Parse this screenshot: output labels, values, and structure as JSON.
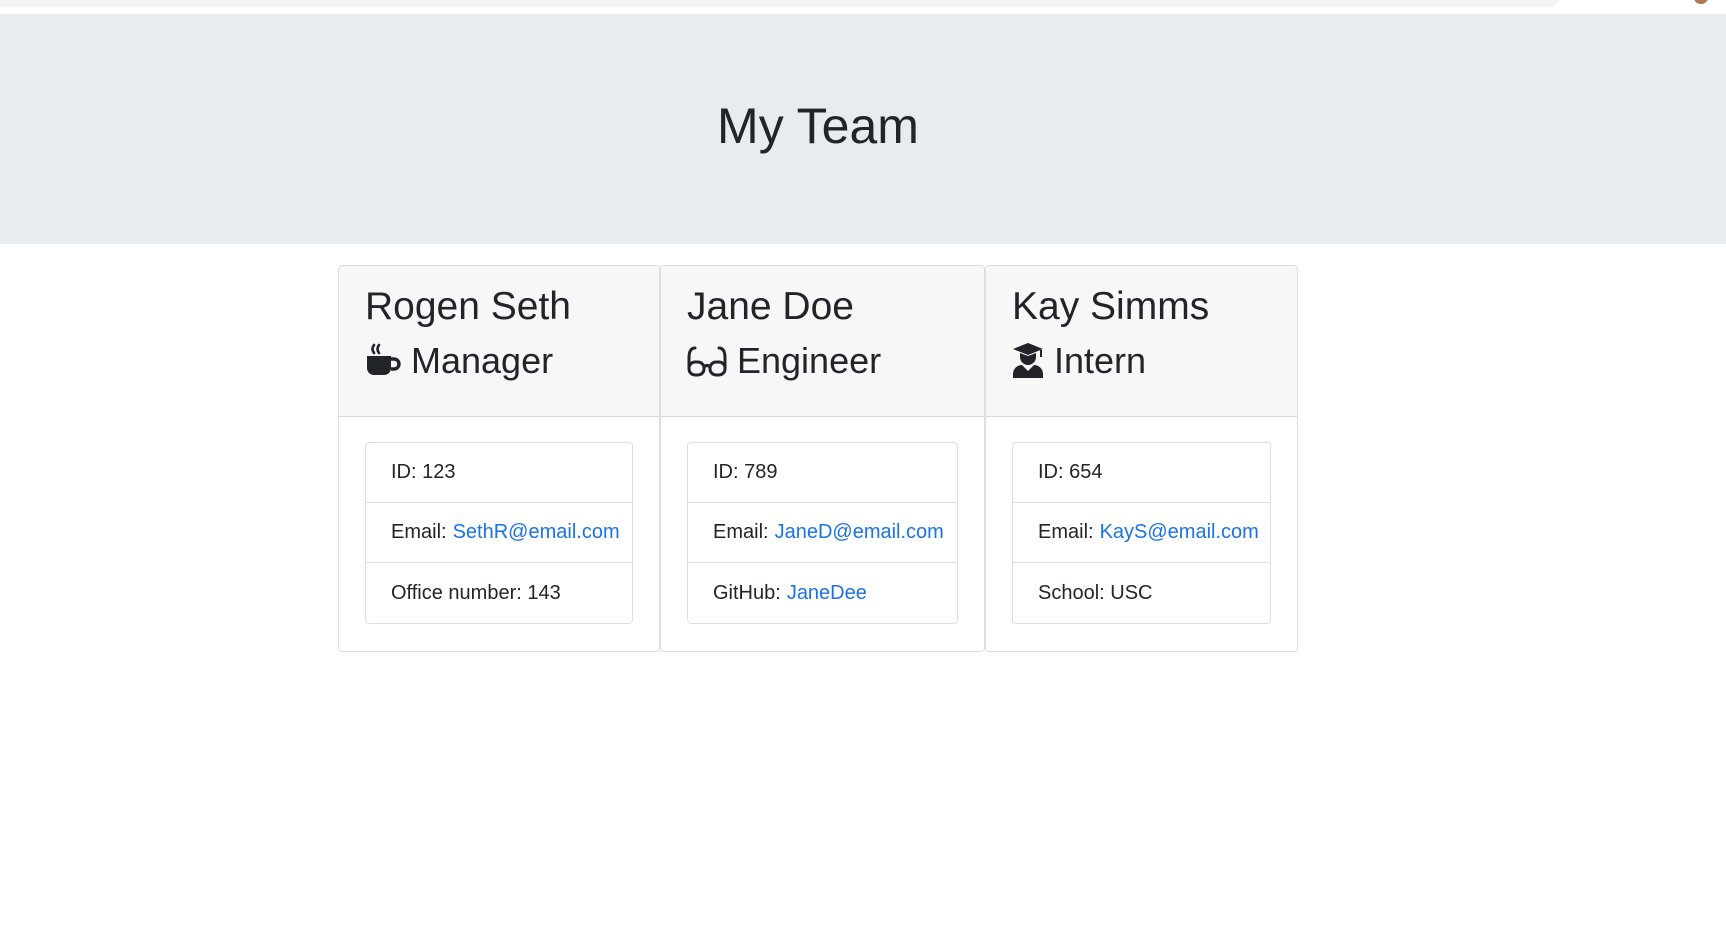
{
  "header": {
    "title": "My Team"
  },
  "employees": [
    {
      "name": "Rogen Seth",
      "role": "Manager",
      "icon": "coffee-mug-icon",
      "id_text": "ID: 123",
      "email_label": "Email:",
      "email": "SethR@email.com",
      "extra_label": "Office number: 143",
      "extra_link": ""
    },
    {
      "name": "Jane Doe",
      "role": "Engineer",
      "icon": "glasses-icon",
      "id_text": "ID: 789",
      "email_label": "Email:",
      "email": "JaneD@email.com",
      "extra_label": "GitHub:",
      "extra_link": "JaneDee"
    },
    {
      "name": "Kay Simms",
      "role": "Intern",
      "icon": "graduate-icon",
      "id_text": "ID: 654",
      "email_label": "Email:",
      "email": "KayS@email.com",
      "extra_label": "School: USC",
      "extra_link": ""
    }
  ],
  "colors": {
    "jumbotron": "#e9ecef",
    "link": "#1a73e8",
    "card_header": "#f7f7f7"
  }
}
